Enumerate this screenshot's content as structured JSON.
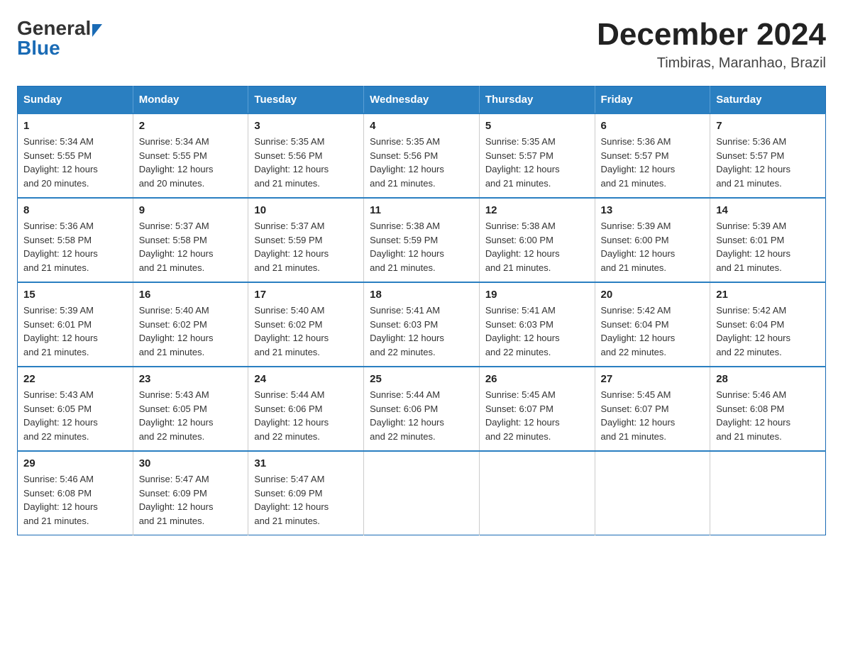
{
  "header": {
    "logo_general": "General",
    "logo_blue": "Blue",
    "title": "December 2024",
    "subtitle": "Timbiras, Maranhao, Brazil"
  },
  "days_of_week": [
    "Sunday",
    "Monday",
    "Tuesday",
    "Wednesday",
    "Thursday",
    "Friday",
    "Saturday"
  ],
  "weeks": [
    [
      {
        "day": "1",
        "sunrise": "5:34 AM",
        "sunset": "5:55 PM",
        "daylight": "12 hours and 20 minutes."
      },
      {
        "day": "2",
        "sunrise": "5:34 AM",
        "sunset": "5:55 PM",
        "daylight": "12 hours and 20 minutes."
      },
      {
        "day": "3",
        "sunrise": "5:35 AM",
        "sunset": "5:56 PM",
        "daylight": "12 hours and 21 minutes."
      },
      {
        "day": "4",
        "sunrise": "5:35 AM",
        "sunset": "5:56 PM",
        "daylight": "12 hours and 21 minutes."
      },
      {
        "day": "5",
        "sunrise": "5:35 AM",
        "sunset": "5:57 PM",
        "daylight": "12 hours and 21 minutes."
      },
      {
        "day": "6",
        "sunrise": "5:36 AM",
        "sunset": "5:57 PM",
        "daylight": "12 hours and 21 minutes."
      },
      {
        "day": "7",
        "sunrise": "5:36 AM",
        "sunset": "5:57 PM",
        "daylight": "12 hours and 21 minutes."
      }
    ],
    [
      {
        "day": "8",
        "sunrise": "5:36 AM",
        "sunset": "5:58 PM",
        "daylight": "12 hours and 21 minutes."
      },
      {
        "day": "9",
        "sunrise": "5:37 AM",
        "sunset": "5:58 PM",
        "daylight": "12 hours and 21 minutes."
      },
      {
        "day": "10",
        "sunrise": "5:37 AM",
        "sunset": "5:59 PM",
        "daylight": "12 hours and 21 minutes."
      },
      {
        "day": "11",
        "sunrise": "5:38 AM",
        "sunset": "5:59 PM",
        "daylight": "12 hours and 21 minutes."
      },
      {
        "day": "12",
        "sunrise": "5:38 AM",
        "sunset": "6:00 PM",
        "daylight": "12 hours and 21 minutes."
      },
      {
        "day": "13",
        "sunrise": "5:39 AM",
        "sunset": "6:00 PM",
        "daylight": "12 hours and 21 minutes."
      },
      {
        "day": "14",
        "sunrise": "5:39 AM",
        "sunset": "6:01 PM",
        "daylight": "12 hours and 21 minutes."
      }
    ],
    [
      {
        "day": "15",
        "sunrise": "5:39 AM",
        "sunset": "6:01 PM",
        "daylight": "12 hours and 21 minutes."
      },
      {
        "day": "16",
        "sunrise": "5:40 AM",
        "sunset": "6:02 PM",
        "daylight": "12 hours and 21 minutes."
      },
      {
        "day": "17",
        "sunrise": "5:40 AM",
        "sunset": "6:02 PM",
        "daylight": "12 hours and 21 minutes."
      },
      {
        "day": "18",
        "sunrise": "5:41 AM",
        "sunset": "6:03 PM",
        "daylight": "12 hours and 22 minutes."
      },
      {
        "day": "19",
        "sunrise": "5:41 AM",
        "sunset": "6:03 PM",
        "daylight": "12 hours and 22 minutes."
      },
      {
        "day": "20",
        "sunrise": "5:42 AM",
        "sunset": "6:04 PM",
        "daylight": "12 hours and 22 minutes."
      },
      {
        "day": "21",
        "sunrise": "5:42 AM",
        "sunset": "6:04 PM",
        "daylight": "12 hours and 22 minutes."
      }
    ],
    [
      {
        "day": "22",
        "sunrise": "5:43 AM",
        "sunset": "6:05 PM",
        "daylight": "12 hours and 22 minutes."
      },
      {
        "day": "23",
        "sunrise": "5:43 AM",
        "sunset": "6:05 PM",
        "daylight": "12 hours and 22 minutes."
      },
      {
        "day": "24",
        "sunrise": "5:44 AM",
        "sunset": "6:06 PM",
        "daylight": "12 hours and 22 minutes."
      },
      {
        "day": "25",
        "sunrise": "5:44 AM",
        "sunset": "6:06 PM",
        "daylight": "12 hours and 22 minutes."
      },
      {
        "day": "26",
        "sunrise": "5:45 AM",
        "sunset": "6:07 PM",
        "daylight": "12 hours and 22 minutes."
      },
      {
        "day": "27",
        "sunrise": "5:45 AM",
        "sunset": "6:07 PM",
        "daylight": "12 hours and 21 minutes."
      },
      {
        "day": "28",
        "sunrise": "5:46 AM",
        "sunset": "6:08 PM",
        "daylight": "12 hours and 21 minutes."
      }
    ],
    [
      {
        "day": "29",
        "sunrise": "5:46 AM",
        "sunset": "6:08 PM",
        "daylight": "12 hours and 21 minutes."
      },
      {
        "day": "30",
        "sunrise": "5:47 AM",
        "sunset": "6:09 PM",
        "daylight": "12 hours and 21 minutes."
      },
      {
        "day": "31",
        "sunrise": "5:47 AM",
        "sunset": "6:09 PM",
        "daylight": "12 hours and 21 minutes."
      },
      null,
      null,
      null,
      null
    ]
  ],
  "labels": {
    "sunrise": "Sunrise:",
    "sunset": "Sunset:",
    "daylight": "Daylight:"
  }
}
